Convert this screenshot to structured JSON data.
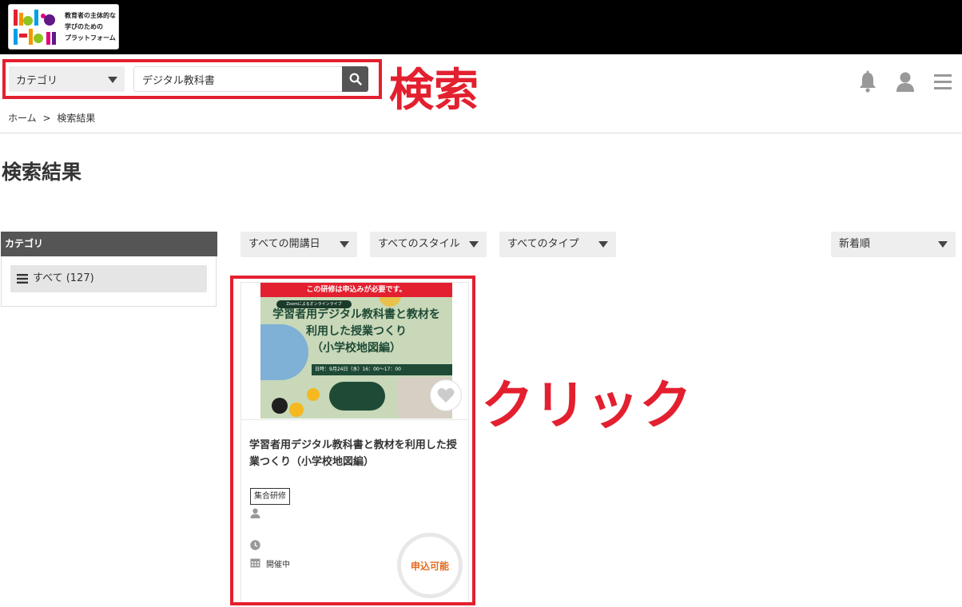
{
  "header": {
    "logo_lines": [
      "教育者の主体的な",
      "学びのための",
      "プラットフォーム"
    ]
  },
  "search": {
    "category_label": "カテゴリ",
    "query": "デジタル教科書"
  },
  "annotations": {
    "search_label": "検索",
    "click_label": "クリック",
    "color": "#e3202f"
  },
  "icons": [
    "bell-icon",
    "user-icon",
    "hamburger-menu-icon",
    "search-icon",
    "heart-icon",
    "clock-icon",
    "calendar-icon"
  ],
  "breadcrumb": {
    "home": "ホーム",
    "separator": ">",
    "current": "検索結果"
  },
  "page": {
    "title": "検索結果"
  },
  "sidebar": {
    "heading": "カテゴリ",
    "items": [
      {
        "label": "すべて (127)"
      }
    ]
  },
  "filters": {
    "date": "すべての開講日",
    "style": "すべてのスタイル",
    "type": "すべてのタイプ",
    "sort": "新着順"
  },
  "card": {
    "thumb": {
      "banner": "この研修は申込みが必要です。",
      "pill": "Zoomによるオンラインライブ",
      "title_lines": [
        "学習者用デジタル教科書と教材を",
        "利用した授業つくり",
        "（小学校地図編）"
      ],
      "date": "日時：9月24日（水）16：00〜17：00"
    },
    "title": "学習者用デジタル教科書と教材を利用した授業つくり（小学校地図編）",
    "tag": "集合研修",
    "status_text": "開催中",
    "badge": "申込可能",
    "badge_color": "#e36a1e"
  }
}
